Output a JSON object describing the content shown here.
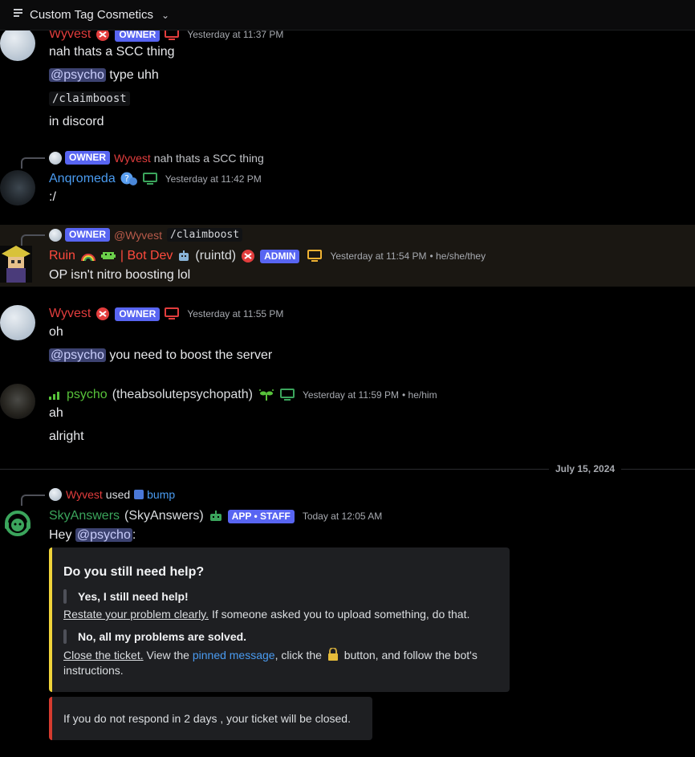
{
  "channel": {
    "title": "Custom Tag Cosmetics"
  },
  "messages": {
    "m1": {
      "author": "Wyvest",
      "tag": "OWNER",
      "timestamp": "Yesterday at 11:37 PM",
      "lines": [
        "nah thats a SCC thing",
        "type uhh",
        "/claimboost",
        "in discord"
      ],
      "mention": "@psycho"
    },
    "m2": {
      "reply_tag": "OWNER",
      "reply_author": "Wyvest",
      "reply_text": "nah thats a SCC thing",
      "author": "Anqromeda",
      "timestamp": "Yesterday at 11:42 PM",
      "text": ":/"
    },
    "m3": {
      "reply_tag": "OWNER",
      "reply_author": "@Wyvest",
      "reply_code": "/claimboost",
      "author": "Ruin",
      "author_suffix": "| Bot Dev",
      "handle": "(ruintd)",
      "tag": "ADMIN",
      "timestamp": "Yesterday at 11:54 PM",
      "pronouns": "• he/she/they",
      "text": "OP isn't nitro boosting lol"
    },
    "m4": {
      "author": "Wyvest",
      "tag": "OWNER",
      "timestamp": "Yesterday at 11:55 PM",
      "text1": "oh",
      "mention": "@psycho",
      "text2": "you need to boost the server"
    },
    "m5": {
      "author": "psycho",
      "handle": "(theabsolutepsychopath)",
      "timestamp": "Yesterday at 11:59 PM",
      "pronouns": "• he/him",
      "text1": "ah",
      "text2": "alright"
    },
    "date_divider": "July 15, 2024",
    "m6": {
      "reply_author": "Wyvest",
      "reply_used": "used",
      "reply_command": "bump",
      "author": "SkyAnswers",
      "handle": "(SkyAnswers)",
      "tag": "APP • STAFF",
      "timestamp": "Today at 12:05 AM",
      "greeting": "Hey",
      "mention": "@psycho",
      "colon": ":",
      "embed": {
        "title": "Do you still need help?",
        "q1": "Yes, I still need help!",
        "q1_link": "Restate your problem clearly.",
        "q1_rest": "If someone asked you to upload something, do that.",
        "q2": "No, all my problems are solved.",
        "q2_link": "Close the ticket.",
        "q2_view": "View the",
        "q2_pinned": "pinned message",
        "q2_click": ", click the",
        "q2_rest": "button, and follow the bot's",
        "q2_rest2": "instructions."
      },
      "embed2": {
        "text": "If you do not respond  in 2 days , your ticket will be closed."
      }
    }
  },
  "colors": {
    "owner": "#e23d3d",
    "mention_bg": "#3c4270",
    "tag_bg": "#5865f2",
    "embed_yellow": "#f0d43a",
    "embed_red": "#d63b2f"
  }
}
